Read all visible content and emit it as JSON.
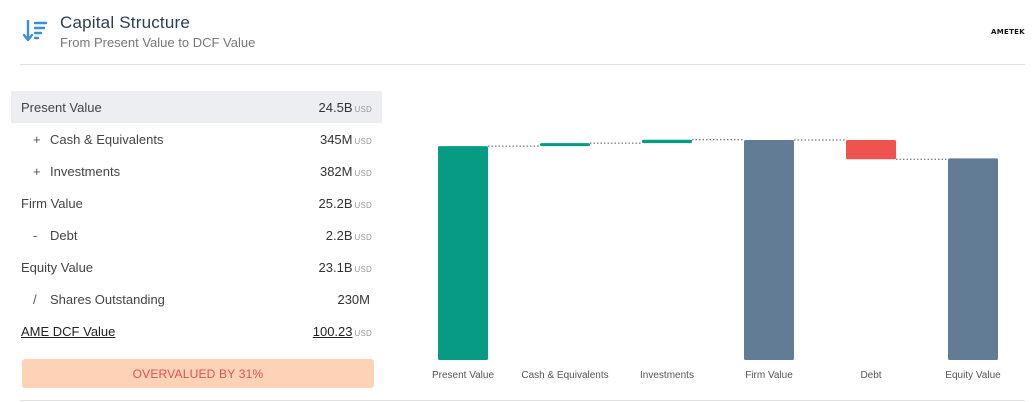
{
  "header": {
    "title": "Capital Structure",
    "subtitle": "From Present Value to DCF Value",
    "brand": "AMETEK",
    "icon": "sort-descending-icon",
    "icon_color": "#3a8fdb"
  },
  "table": {
    "rows": [
      {
        "op": "",
        "label": "Present Value",
        "value": "24.5B",
        "unit": "USD"
      },
      {
        "op": "+",
        "label": "Cash & Equivalents",
        "value": "345M",
        "unit": "USD"
      },
      {
        "op": "+",
        "label": "Investments",
        "value": "382M",
        "unit": "USD"
      },
      {
        "op": "",
        "label": "Firm Value",
        "value": "25.2B",
        "unit": "USD"
      },
      {
        "op": "-",
        "label": "Debt",
        "value": "2.2B",
        "unit": "USD"
      },
      {
        "op": "",
        "label": "Equity Value",
        "value": "23.1B",
        "unit": "USD"
      },
      {
        "op": "/",
        "label": "Shares Outstanding",
        "value": "230M",
        "unit": ""
      },
      {
        "op": "",
        "label": "AME DCF Value",
        "value": "100.23",
        "unit": "USD"
      }
    ]
  },
  "badge": {
    "text": "OVERVALUED BY 31%",
    "bg_color": "#fdd2b6",
    "text_color": "#d9534f"
  },
  "chart_data": {
    "type": "bar",
    "subtype": "waterfall",
    "categories": [
      "Present Value",
      "Cash & Equivalents",
      "Investments",
      "Firm Value",
      "Debt",
      "Equity Value"
    ],
    "values": [
      24.5,
      0.345,
      0.382,
      25.2,
      -2.2,
      23.1
    ],
    "kinds": [
      "total",
      "increase",
      "increase",
      "total",
      "decrease",
      "total"
    ],
    "unit": "B USD",
    "colors": {
      "positive": "#069b82",
      "total": "#627c96",
      "negative": "#ef5350",
      "connector": "#555555"
    },
    "bar_colors": [
      "#069b82",
      "#069b82",
      "#069b82",
      "#627c96",
      "#ef5350",
      "#627c96"
    ],
    "ylim": [
      0,
      25.2
    ],
    "grid": false,
    "title": "",
    "xlabel": "",
    "ylabel": ""
  }
}
